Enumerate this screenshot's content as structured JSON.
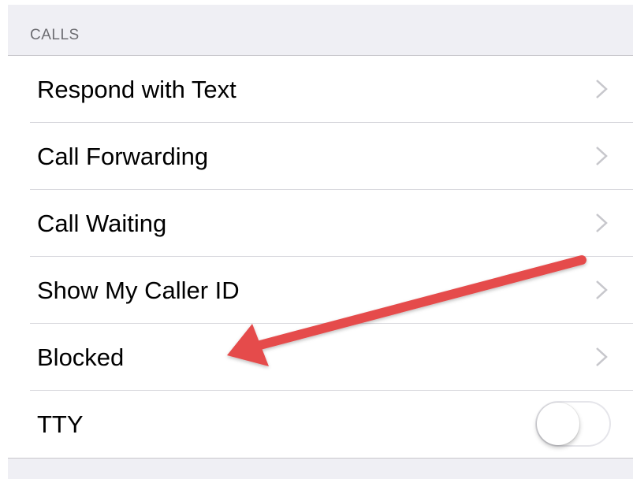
{
  "section": {
    "header": "CALLS"
  },
  "rows": [
    {
      "label": "Respond with Text",
      "accessory": "chevron-right-icon"
    },
    {
      "label": "Call Forwarding",
      "accessory": "chevron-right-icon"
    },
    {
      "label": "Call Waiting",
      "accessory": "chevron-right-icon"
    },
    {
      "label": "Show My Caller ID",
      "accessory": "chevron-right-icon"
    },
    {
      "label": "Blocked",
      "accessory": "chevron-right-icon"
    },
    {
      "label": "TTY",
      "accessory": "toggle",
      "toggle_on": false
    }
  ],
  "annotation": {
    "arrow_color": "#e54b4b",
    "points_to": "Blocked"
  },
  "colors": {
    "background": "#efeff4",
    "chevron": "#c7c7cc",
    "header_text": "#6d6d72"
  }
}
